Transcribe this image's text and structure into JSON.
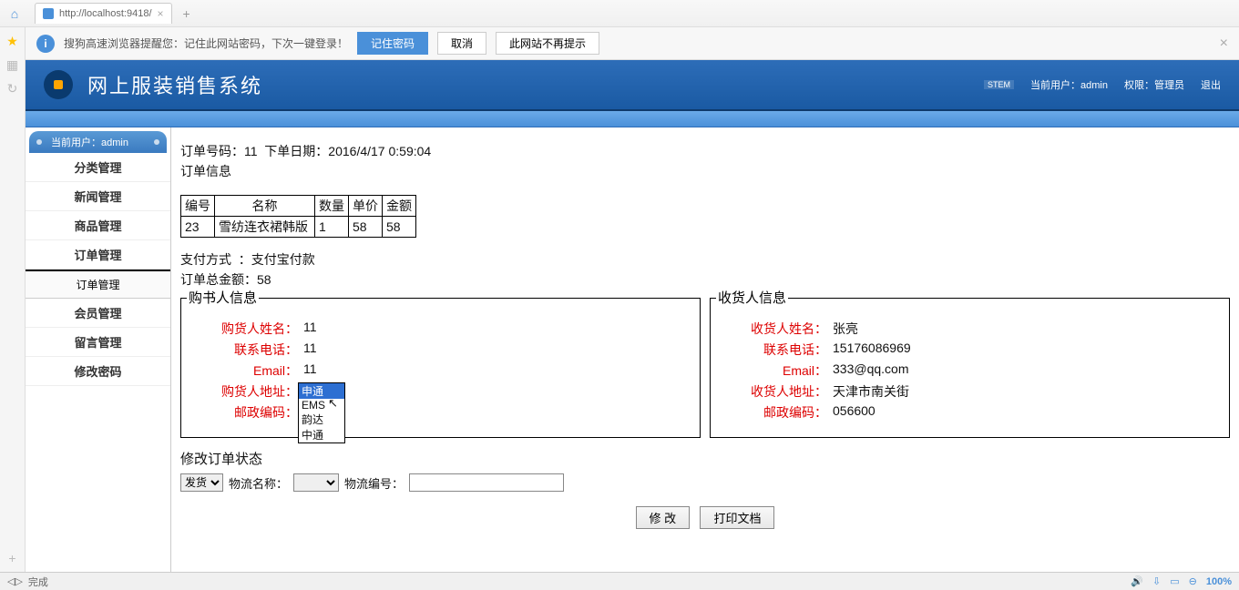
{
  "browser": {
    "tab_url": "http://localhost:9418/",
    "tab_add": "+",
    "nav_home": "⌂",
    "nav_back_fwd": "◁▷"
  },
  "infobar": {
    "icon": "i",
    "text": "搜狗高速浏览器提醒您：记住此网站密码，下次一键登录！",
    "btn_remember": "记住密码",
    "btn_cancel": "取消",
    "btn_never": "此网站不再提示"
  },
  "app": {
    "title": "网上服装销售系统",
    "stem": "STEM",
    "cur_user_label": "当前用户：",
    "cur_user": "admin",
    "role_label": "权限：",
    "role": "管理员",
    "logout": "退出"
  },
  "sidebar": {
    "head": "当前用户：admin",
    "items": [
      "分类管理",
      "新闻管理",
      "商品管理",
      "订单管理"
    ],
    "sub": "订单管理",
    "items2": [
      "会员管理",
      "留言管理",
      "修改密码"
    ]
  },
  "order": {
    "line": "订单号码：11  下单日期：2016/4/17 0:59:04",
    "info_title": "订单信息",
    "headers": [
      "编号",
      "名称",
      "数量",
      "单价",
      "金额"
    ],
    "row": [
      "23",
      "雪纺连衣裙韩版",
      "1",
      "58",
      "58"
    ],
    "pay": "支付方式  ：支付宝付款",
    "total": "订单总金额：58"
  },
  "buyer": {
    "legend": "购书人信息",
    "fields": [
      {
        "label": "购货人姓名：",
        "val": "11"
      },
      {
        "label": "联系电话：",
        "val": "11"
      },
      {
        "label": "Email：",
        "val": "11"
      },
      {
        "label": "购货人地址：",
        "val": ""
      },
      {
        "label": "邮政编码：",
        "val": ""
      }
    ]
  },
  "receiver": {
    "legend": "收货人信息",
    "fields": [
      {
        "label": "收货人姓名：",
        "val": "张亮"
      },
      {
        "label": "联系电话：",
        "val": "15176086969"
      },
      {
        "label": "Email：",
        "val": "333@qq.com"
      },
      {
        "label": "收货人地址：",
        "val": "天津市南关街"
      },
      {
        "label": "邮政编码：",
        "val": "056600"
      }
    ]
  },
  "dropdown": {
    "options": [
      "申通",
      "EMS",
      "韵达",
      "中通"
    ],
    "selected": "申通"
  },
  "modify": {
    "title": "修改订单状态",
    "ship_label": "发货",
    "logistics_name_label": "物流名称：",
    "logistics_no_label": "物流编号：",
    "btn_modify": "修 改",
    "btn_print": "打印文档"
  },
  "status": {
    "done": "完成",
    "zoom": "100%"
  }
}
